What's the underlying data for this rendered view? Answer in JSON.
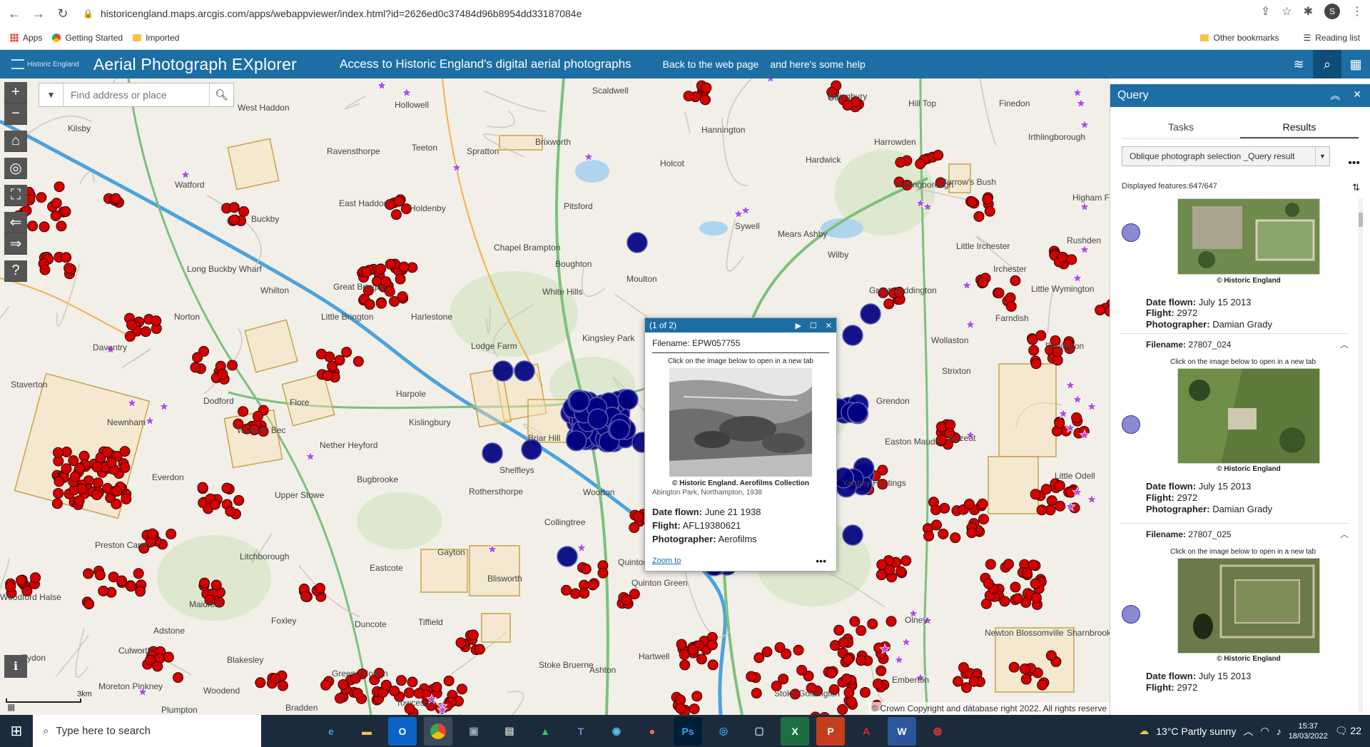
{
  "browser": {
    "url": "historicengland.maps.arcgis.com/apps/webappviewer/index.html?id=2626ed0c37484d96b8954dd33187084e",
    "avatar_letter": "S",
    "bookmarks": [
      "Apps",
      "Getting Started",
      "Imported"
    ],
    "bookmarks_right": [
      "Other bookmarks",
      "Reading list"
    ]
  },
  "header": {
    "logo_text": "Historic England",
    "title": "Aerial Photograph EXplorer",
    "subtitle": "Access to Historic England's digital aerial photographs",
    "link_back": "Back to the web page",
    "link_help": "and here's some help"
  },
  "map": {
    "search_placeholder": "Find address or place",
    "scale_label": "3km",
    "copyright": "© Crown Copyright and database right 2022. All rights reserve",
    "places": [
      "Kilsby",
      "West Haddon",
      "Hollowell",
      "Scaldwell",
      "Old",
      "Orlingbury",
      "Hill Top",
      "Finedon",
      "Irthlingborough",
      "Ravensthorpe",
      "Teeton",
      "Spratton",
      "Brixworth",
      "Hannington",
      "Harrowden",
      "Hardwick",
      "Burrow's Bush",
      "Watford",
      "East Haddon",
      "Holcot",
      "Wellingborough",
      "Buckby",
      "Holdenby",
      "Pitsford",
      "Sywell",
      "Mears Ashby",
      "Long Buckby Wharf",
      "Chapel Brampton",
      "Boughton",
      "Wilby",
      "Little Irchester",
      "Irchester",
      "Whilton",
      "Great Brington",
      "Moulton",
      "Great Doddington",
      "Norton",
      "Little Brington",
      "White Hills",
      "Harlestone",
      "Kingsley Park",
      "Farndish",
      "Daventry",
      "Lodge Farm",
      "Wollaston",
      "Podington",
      "Strixton",
      "Staverton",
      "Harpole",
      "Dodford",
      "Flore",
      "Kislingbury",
      "Grendon",
      "Bozeat",
      "Newnham",
      "Weedon Bec",
      "Nether Heyford",
      "Briar Hill",
      "Easton Maudit",
      "Shelfleys",
      "Yardley Hastings",
      "Bugbrooke",
      "Rothersthorpe",
      "Wootton",
      "Everdon",
      "Upper Stowe",
      "Collingtree",
      "Hackleton",
      "Preston Capes",
      "Litchborough",
      "Gayton",
      "Blisworth",
      "Quinton",
      "The Wold",
      "Eastcote",
      "Quinton Green",
      "Maidford",
      "Foxley",
      "Tiffield",
      "Adstone",
      "Duncote",
      "Hartwell",
      "Blakesley",
      "Greens Norton",
      "Stoke Bruerne",
      "Ashton",
      "Woodend",
      "Plumpton",
      "Bradden",
      "Towcester",
      "Stoke Goldington",
      "Emberton",
      "Olney",
      "Newton Blossomville",
      "Moreton Pinkney",
      "Woodford Halse",
      "Culworth",
      "Eydon",
      "Little Odell",
      "Sharnbrook",
      "Rushden",
      "Little Wymington",
      "Higham Ferrers"
    ]
  },
  "popup": {
    "counter": "(1 of 2)",
    "filename_label": "Filename:",
    "filename": "EPW057755",
    "hint": "Click on the image below to open in a new tab",
    "caption": "© Historic England. Aerofilms Collection",
    "sub": "Abington Park, Northampton, 1938",
    "date_label": "Date flown:",
    "date": "June 21 1938",
    "flight_label": "Flight:",
    "flight": "AFL19380621",
    "photographer_label": "Photographer:",
    "photographer": "Aerofilms",
    "zoom": "Zoom to"
  },
  "panel": {
    "title": "Query",
    "tabs": [
      "Tasks",
      "Results"
    ],
    "selected_result": "Oblique photograph selection _Query result",
    "displayed": "Displayed features:647/647",
    "items": [
      {
        "filename": "",
        "copyright": "© Historic England",
        "date": "July 15 2013",
        "flight": "2972",
        "photographer": "Damian Grady"
      },
      {
        "filename": "27807_024",
        "hint": "Click on the image below to open in a new tab",
        "copyright": "© Historic England",
        "date": "July 15 2013",
        "flight": "2972",
        "photographer": "Damian Grady"
      },
      {
        "filename": "27807_025",
        "hint": "Click on the image below to open in a new tab",
        "copyright": "© Historic England",
        "date": "July 15 2013",
        "flight": "2972",
        "photographer": ""
      }
    ],
    "labels": {
      "filename": "Filename:",
      "date": "Date flown:",
      "flight": "Flight:",
      "photographer": "Photographer:"
    }
  },
  "taskbar": {
    "search_placeholder": "Type here to search",
    "weather": "13°C  Partly sunny",
    "time": "15:37",
    "date": "18/03/2022",
    "notifications": "22"
  },
  "colors": {
    "accent": "#1c6ea4",
    "red_points": "#d40000",
    "blue_points": "#000080",
    "purple_points": "#b04fe0"
  }
}
